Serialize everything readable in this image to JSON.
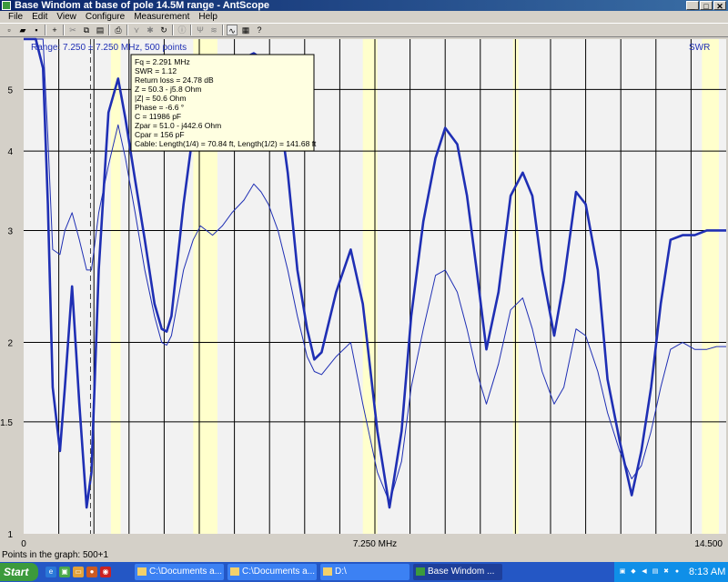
{
  "window": {
    "title": "Base Windom at base of pole 14.5M range - AntScope",
    "btn_min": "_",
    "btn_max": "□",
    "btn_close": "✕"
  },
  "menu": [
    "File",
    "Edit",
    "View",
    "Configure",
    "Measurement",
    "Help"
  ],
  "toolbar_icons": [
    "new-icon",
    "open-icon",
    "save-icon",
    "add-icon",
    "cut-icon",
    "copy-icon",
    "paste-icon",
    "print-icon",
    "scan-icon",
    "star-icon",
    "refresh-icon",
    "info-icon",
    "antenna-icon",
    "fq-icon",
    "graph-icon",
    "table-icon",
    "help-icon"
  ],
  "plot": {
    "range_label": "Range: 7.250 ± 7.250 MHz, 500 points",
    "right_label": "SWR",
    "colors": {
      "grid_bg": "#f2f2f2",
      "band": "#ffffcc",
      "curve": "#1f2fb4"
    }
  },
  "chart_data": {
    "type": "line",
    "x_ticks": [
      "0",
      "7.250 MHz",
      "14.500"
    ],
    "y_ticks": [
      "1",
      "1.5",
      "2",
      "3",
      "4",
      "5"
    ],
    "xlim": [
      0,
      14.5
    ],
    "ylim_log": [
      1,
      6
    ],
    "series": [
      {
        "weight": "bold",
        "x": [
          0.0,
          0.25,
          0.4,
          0.5,
          0.6,
          0.75,
          0.85,
          1.0,
          1.15,
          1.3,
          1.4,
          1.55,
          1.75,
          1.95,
          2.1,
          2.3,
          2.5,
          2.7,
          2.85,
          2.95,
          3.05,
          3.3,
          3.5,
          3.65,
          3.9,
          4.1,
          4.3,
          4.55,
          4.75,
          4.9,
          5.05,
          5.25,
          5.45,
          5.65,
          5.85,
          6.0,
          6.15,
          6.45,
          6.75,
          7.0,
          7.3,
          7.55,
          7.8,
          8.0,
          8.25,
          8.5,
          8.7,
          8.95,
          9.15,
          9.35,
          9.55,
          9.8,
          10.05,
          10.3,
          10.5,
          10.7,
          10.95,
          11.15,
          11.4,
          11.6,
          11.85,
          12.05,
          12.3,
          12.55,
          12.75,
          12.95,
          13.15,
          13.35,
          13.6,
          13.85,
          14.1,
          14.3,
          14.5
        ],
        "y": [
          6.0,
          6.0,
          5.4,
          3.3,
          1.7,
          1.35,
          1.7,
          2.45,
          1.6,
          1.1,
          1.25,
          2.6,
          4.6,
          5.2,
          4.5,
          3.6,
          2.9,
          2.3,
          2.1,
          2.08,
          2.2,
          3.3,
          4.3,
          4.9,
          4.6,
          5.0,
          5.5,
          5.6,
          5.7,
          5.6,
          5.4,
          4.8,
          3.7,
          2.6,
          2.1,
          1.88,
          1.93,
          2.4,
          2.8,
          2.3,
          1.45,
          1.1,
          1.45,
          2.2,
          3.1,
          3.9,
          4.35,
          4.1,
          3.4,
          2.6,
          1.95,
          2.4,
          3.4,
          3.7,
          3.4,
          2.6,
          2.05,
          2.5,
          3.45,
          3.3,
          2.6,
          1.75,
          1.4,
          1.15,
          1.35,
          1.7,
          2.3,
          2.9,
          2.95,
          2.95,
          3.0,
          3.0,
          3.0
        ]
      },
      {
        "weight": "thin",
        "x": [
          0.0,
          0.25,
          0.4,
          0.5,
          0.6,
          0.75,
          0.85,
          1.0,
          1.15,
          1.3,
          1.4,
          1.55,
          1.75,
          1.95,
          2.1,
          2.3,
          2.5,
          2.7,
          2.85,
          2.95,
          3.05,
          3.3,
          3.5,
          3.65,
          3.9,
          4.1,
          4.3,
          4.55,
          4.75,
          4.9,
          5.05,
          5.25,
          5.45,
          5.65,
          5.85,
          6.0,
          6.15,
          6.45,
          6.75,
          7.0,
          7.3,
          7.55,
          7.8,
          8.0,
          8.25,
          8.5,
          8.7,
          8.95,
          9.15,
          9.35,
          9.55,
          9.8,
          10.05,
          10.3,
          10.5,
          10.7,
          10.95,
          11.15,
          11.4,
          11.6,
          11.85,
          12.05,
          12.3,
          12.55,
          12.75,
          12.95,
          13.15,
          13.35,
          13.6,
          13.85,
          14.1,
          14.3,
          14.5
        ],
        "y": [
          6.0,
          6.0,
          6.0,
          4.2,
          2.8,
          2.75,
          3.0,
          3.2,
          2.9,
          2.6,
          2.6,
          3.2,
          3.8,
          4.4,
          3.9,
          3.2,
          2.6,
          2.2,
          2.0,
          1.98,
          2.05,
          2.6,
          2.9,
          3.05,
          2.95,
          3.05,
          3.2,
          3.35,
          3.55,
          3.45,
          3.3,
          3.0,
          2.6,
          2.2,
          1.9,
          1.8,
          1.78,
          1.9,
          2.0,
          1.6,
          1.25,
          1.12,
          1.3,
          1.7,
          2.1,
          2.55,
          2.6,
          2.4,
          2.1,
          1.8,
          1.6,
          1.85,
          2.25,
          2.35,
          2.1,
          1.8,
          1.6,
          1.7,
          2.1,
          2.05,
          1.8,
          1.55,
          1.35,
          1.22,
          1.28,
          1.45,
          1.7,
          1.95,
          2.0,
          1.95,
          1.95,
          1.97,
          1.97
        ]
      }
    ],
    "cursor_x": 1.38,
    "bands": [
      [
        1.8,
        2.0
      ],
      [
        3.5,
        4.0
      ],
      [
        7.0,
        7.3
      ],
      [
        10.1,
        10.15
      ],
      [
        14.0,
        14.35
      ]
    ]
  },
  "tooltip": {
    "lines": [
      "Fq = 2.291 MHz",
      "SWR = 1.12",
      "Return loss = 24.78 dB",
      "Z = 50.3 - j5.8 Ohm",
      "|Z| = 50.6 Ohm",
      "Phase = -6.6 °",
      "C = 11986 pF",
      "Zpar = 51.0 - j442.6 Ohm",
      "Cpar = 156 pF",
      "Cable: Length(1/4) = 70.84 ft, Length(1/2) = 141.68 ft"
    ]
  },
  "status": {
    "points": "Points in the graph: 500+1"
  },
  "taskbar": {
    "start": "Start",
    "tasks": [
      "C:\\Documents a...",
      "C:\\Documents a...",
      "D:\\",
      "Base Windom ..."
    ],
    "clock": "8:13 AM"
  }
}
